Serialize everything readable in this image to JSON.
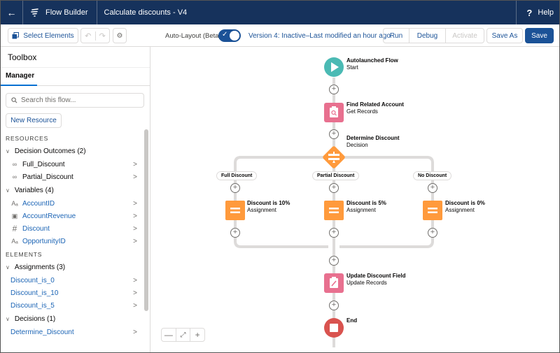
{
  "header": {
    "back_icon": "arrow-left-icon",
    "app_name": "Flow Builder",
    "flow_title": "Calculate discounts - V4",
    "help_label": "Help"
  },
  "toolbar": {
    "select_elements": "Select Elements",
    "undo_icon": "undo-icon",
    "redo_icon": "redo-icon",
    "settings_icon": "gear-icon",
    "auto_layout_label": "Auto-Layout (Beta)",
    "auto_layout_on": true,
    "version_status": "Version 4: Inactive–Last modified an hour ago",
    "run": "Run",
    "debug": "Debug",
    "activate": "Activate",
    "save_as": "Save As",
    "save": "Save"
  },
  "sidebar": {
    "title": "Toolbox",
    "tab": "Manager",
    "search_placeholder": "Search this flow...",
    "new_resource": "New Resource",
    "resources_heading": "RESOURCES",
    "decision_outcomes": {
      "label": "Decision Outcomes (2)",
      "items": [
        "Full_Discount",
        "Partial_Discount"
      ]
    },
    "variables": {
      "label": "Variables (4)",
      "items": [
        {
          "icon": "text-variable-icon",
          "glyph": "Aₐ",
          "name": "AccountID"
        },
        {
          "icon": "currency-variable-icon",
          "glyph": "▣",
          "name": "AccountRevenue"
        },
        {
          "icon": "number-variable-icon",
          "glyph": "#",
          "name": "Discount"
        },
        {
          "icon": "text-variable-icon",
          "glyph": "Aₐ",
          "name": "OpportunityID"
        }
      ]
    },
    "elements_heading": "ELEMENTS",
    "assignments": {
      "label": "Assignments (3)",
      "items": [
        "Discount_is_0",
        "Discount_is_10",
        "Discount_is_5"
      ]
    },
    "decisions": {
      "label": "Decisions (1)",
      "items": [
        "Determine_Discount"
      ]
    }
  },
  "canvas": {
    "start": {
      "title": "Autolaunched Flow",
      "subtitle": "Start"
    },
    "get_records": {
      "title": "Find Related Account",
      "subtitle": "Get Records"
    },
    "decision": {
      "title": "Determine Discount",
      "subtitle": "Decision"
    },
    "branches": [
      {
        "outcome": "Full Discount",
        "title": "Discount is 10%",
        "subtitle": "Assignment"
      },
      {
        "outcome": "Partial Discount",
        "title": "Discount is 5%",
        "subtitle": "Assignment"
      },
      {
        "outcome": "No Discount",
        "title": "Discount is 0%",
        "subtitle": "Assignment"
      }
    ],
    "update_records": {
      "title": "Update Discount Field",
      "subtitle": "Update Records"
    },
    "end": {
      "title": "End"
    },
    "colors": {
      "start": "#4bbab4",
      "records": "#e8708f",
      "decision": "#ff9a3c",
      "assignment": "#ff9a3c",
      "end": "#d9534f",
      "connector": "#dddbda"
    }
  }
}
